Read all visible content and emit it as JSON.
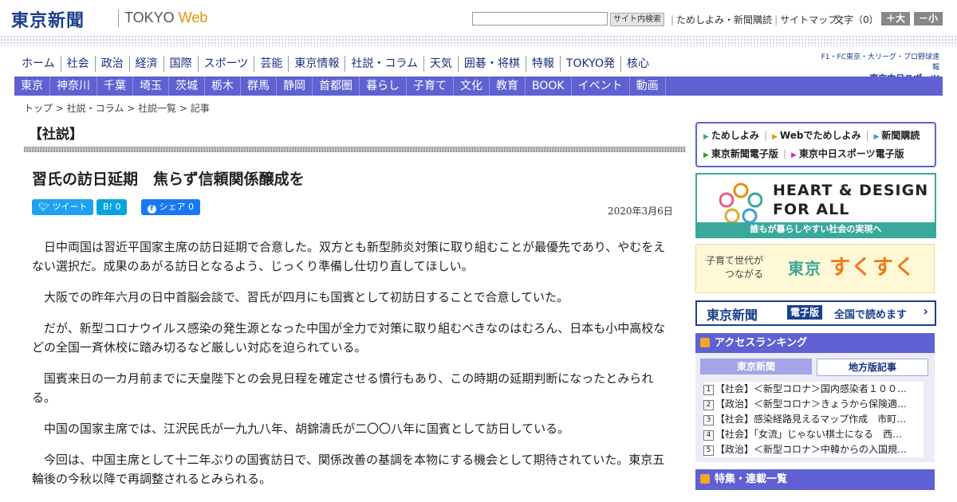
{
  "header": {
    "logo": "東京新聞",
    "logo_sub_a": "TOKYO ",
    "logo_sub_b": "Web",
    "search_button": "サイト内検索",
    "util_links": [
      "ためしよみ・新聞購読",
      "サイトマップ"
    ],
    "fontsize_label": "文字（0）",
    "font_plus": "＋大",
    "font_minus": "－小"
  },
  "main_nav": [
    "ホーム",
    "社会",
    "政治",
    "経済",
    "国際",
    "スポーツ",
    "芸能",
    "東京情報",
    "社説・コラム",
    "天気",
    "囲碁・将棋",
    "特報",
    "TOKYO発",
    "核心"
  ],
  "chunichi": {
    "line1": "F1・FC東京・大リーグ・プロ野球速報",
    "line2": "東京中日スポーツ"
  },
  "sub_nav": [
    "東京",
    "神奈川",
    "千葉",
    "埼玉",
    "茨城",
    "栃木",
    "群馬",
    "静岡",
    "首都圏",
    "暮らし",
    "子育て",
    "文化",
    "教育",
    "BOOK",
    "イベント",
    "動画"
  ],
  "breadcrumb": "トップ > 社説・コラム > 社説一覧 > 記事",
  "article": {
    "section": "【社説】",
    "headline": "習氏の訪日延期　焦らず信頼関係醸成を",
    "share": {
      "tweet": "ツイート",
      "hatena": "B! 0",
      "facebook": "シェア 0"
    },
    "date": "2020年3月6日",
    "paragraphs": [
      "日中両国は習近平国家主席の訪日延期で合意した。双方とも新型肺炎対策に取り組むことが最優先であり、やむをえない選択だ。成果のあがる訪日となるよう、じっくり準備し仕切り直してほしい。",
      "大阪での昨年六月の日中首脳会談で、習氏が四月にも国賓として初訪日することで合意していた。",
      "だが、新型コロナウイルス感染の発生源となった中国が全力で対策に取り組むべきなのはむろん、日本も小中高校などの全国一斉休校に踏み切るなど厳しい対応を迫られている。",
      "国賓来日の一カ月前までに天皇陛下との会見日程を確定させる慣行もあり、この時期の延期判断になったとみられる。",
      "中国の国家主席では、江沢民氏が一九九八年、胡錦濤氏が二〇〇八年に国賓として訪日している。",
      "今回は、中国主席として十二年ぶりの国賓訪日で、関係改善の基調を本物にする機会として期待されていた。東京五輪後の今秋以降で再調整されるとみられる。"
    ]
  },
  "sidebar": {
    "links_row1": [
      "ためしよみ",
      "Webでためしよみ",
      "新聞購読"
    ],
    "links_row2": [
      "東京新聞電子版",
      "東京中日スポーツ電子版"
    ],
    "link_colors": [
      "#3aa89c",
      "#e8900a",
      "#3a9cd8",
      "#2aa02a",
      "#d82ab8"
    ],
    "heart": {
      "line1": "HEART & DESIGN",
      "line2": "FOR ALL",
      "tagline": "誰もが暮らしやすい社会の実現へ"
    },
    "sukusuku": {
      "small1": "子育て世代が",
      "small2": "つながる",
      "big": "東京",
      "big2": "すくすく"
    },
    "epaper": {
      "name": "東京新聞",
      "badge": "電子版",
      "text": "全国で読めます"
    },
    "ranking": {
      "title": "アクセスランキング",
      "tab_active": "東京新聞",
      "tab_inactive": "地方版記事",
      "items": [
        "【社会】＜新型コロナ＞国内感染者１００…",
        "【政治】＜新型コロナ＞きょうから保険適…",
        "【社会】感染経路見えるマップ作成　市町…",
        "【社会】「女流」じゃない棋士になる　西…",
        "【政治】＜新型コロナ＞中韓からの入国規…"
      ]
    },
    "features": {
      "title": "特集・連載一覧"
    }
  }
}
